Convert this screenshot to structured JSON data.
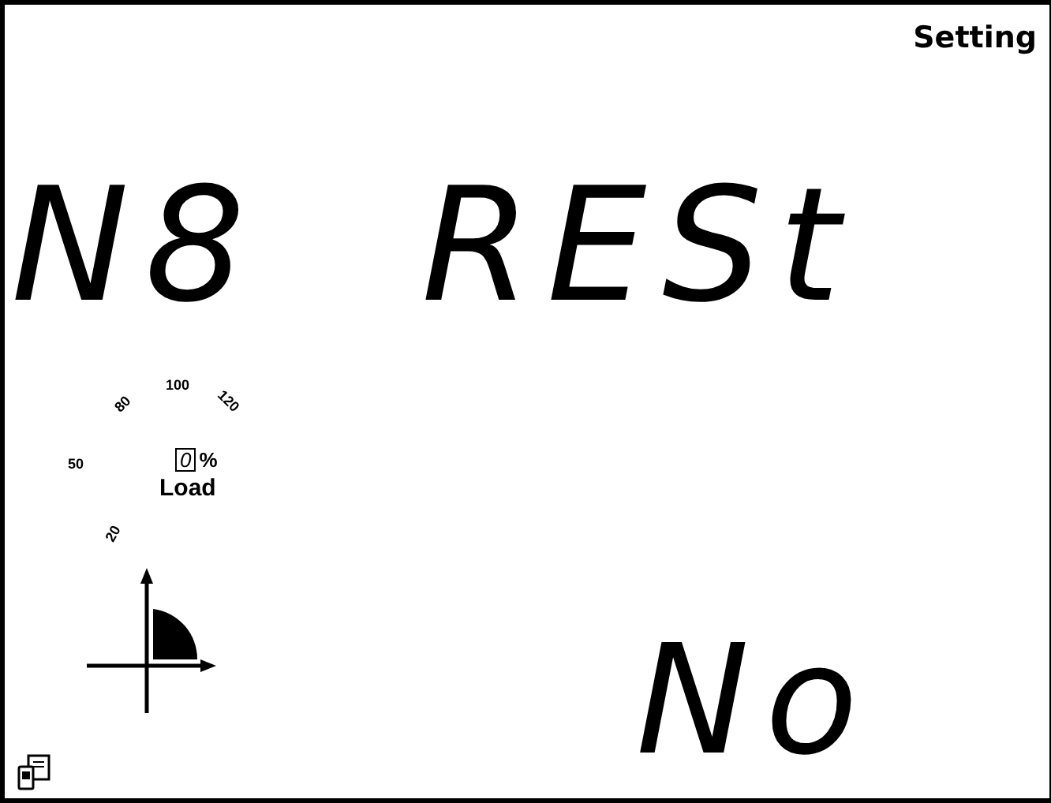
{
  "header": {
    "title": "Setting"
  },
  "display": {
    "code": "N8",
    "parameter": "RESt",
    "value": "No"
  },
  "load_gauge": {
    "scale": [
      "20",
      "50",
      "80",
      "100",
      "120"
    ],
    "reading": "0",
    "unit": "%",
    "label": "Load"
  }
}
